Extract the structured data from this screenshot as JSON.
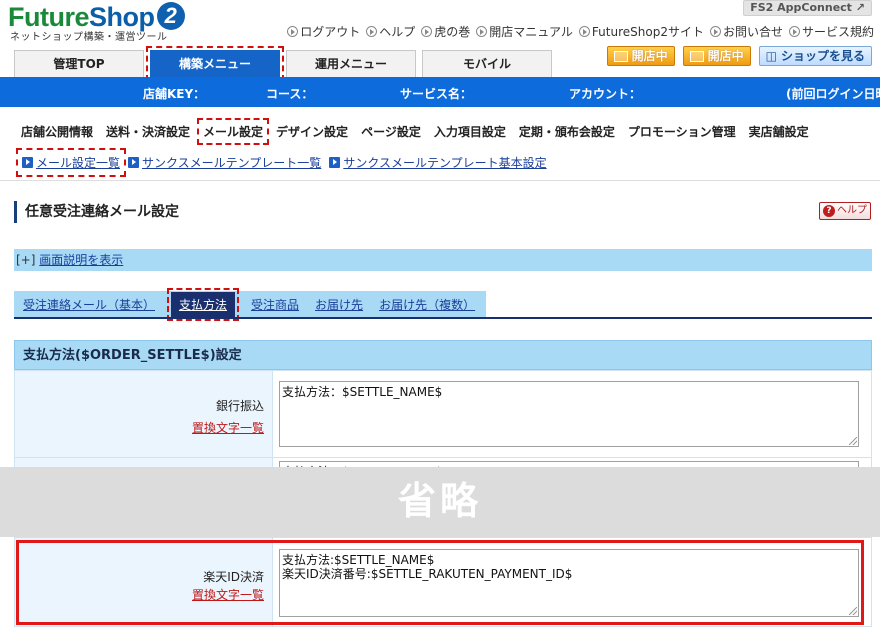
{
  "header": {
    "logo_main_1": "Future",
    "logo_main_2": "Shop",
    "logo_num": "2",
    "logo_sub": "ネットショップ構築・運営ツール",
    "appconnect": "FS2 AppConnect",
    "toplinks": [
      "ログアウト",
      "ヘルプ",
      "虎の巻",
      "開店マニュアル",
      "FutureShop2サイト",
      "お問い合せ",
      "サービス規約"
    ],
    "tabs": [
      {
        "label": "管理TOP"
      },
      {
        "label": "構築メニュー"
      },
      {
        "label": "運用メニュー"
      },
      {
        "label": "モバイル"
      }
    ],
    "status_btn_1": "開店中",
    "status_btn_2": "開店中",
    "shop_btn": "ショップを見る"
  },
  "infobar": {
    "shop_key": "店舗KEY：",
    "course": "コース：",
    "service": "サービス名：",
    "account": "アカウント：",
    "last_login": "(前回ログイン日時"
  },
  "subnav": {
    "items": [
      "店舗公開情報",
      "送料・決済設定",
      "メール設定",
      "デザイン設定",
      "ページ設定",
      "入力項目設定",
      "定期・頒布会設定",
      "プロモーション管理",
      "実店舗設定"
    ],
    "links": [
      "メール設定一覧",
      "サンクスメールテンプレート一覧",
      "サンクスメールテンプレート基本設定"
    ]
  },
  "page": {
    "title": "任意受注連絡メール設定",
    "help": "ヘルプ",
    "explain_plus": "[+]",
    "explain_link": "画面説明を表示"
  },
  "subtabs": [
    "受注連絡メール（基本）",
    "支払方法",
    "受注商品",
    "お届け先",
    "お届け先（複数）"
  ],
  "panel": {
    "header": "支払方法($ORDER_SETTLE$)設定",
    "rows": [
      {
        "name": "銀行振込",
        "rep": "置換文字一覧",
        "text": "支払方法：$SETTLE_NAME$"
      },
      {
        "name": "",
        "rep": "",
        "text": "支払方法：$SETTLE_NAME$"
      },
      {
        "name": "楽天ID決済",
        "rep": "置換文字一覧",
        "text": "支払方法:$SETTLE_NAME$\n楽天ID決済番号:$SETTLE_RAKUTEN_PAYMENT_ID$"
      }
    ]
  },
  "omit_label": "省略"
}
